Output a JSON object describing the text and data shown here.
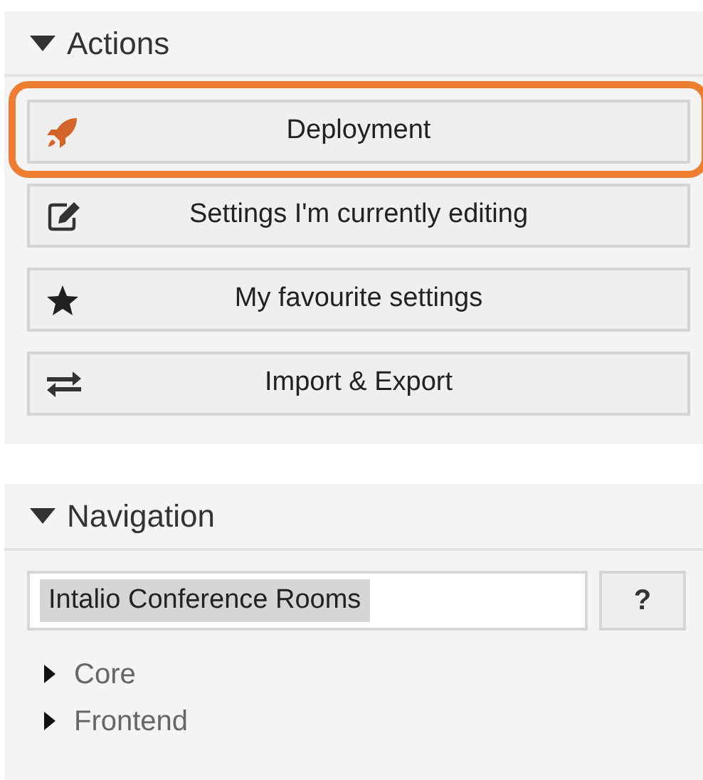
{
  "actions": {
    "title": "Actions",
    "expanded": true,
    "buttons": [
      {
        "label": "Deployment",
        "highlighted": true
      },
      {
        "label": "Settings I'm currently editing",
        "highlighted": false
      },
      {
        "label": "My favourite settings",
        "highlighted": false
      },
      {
        "label": "Import & Export",
        "highlighted": false
      }
    ]
  },
  "navigation": {
    "title": "Navigation",
    "expanded": true,
    "search": {
      "value": "Intalio Conference Rooms",
      "text_selected": true
    },
    "help_button": "?",
    "tree": [
      {
        "label": "Core",
        "expanded": false
      },
      {
        "label": "Frontend",
        "expanded": false
      }
    ]
  }
}
